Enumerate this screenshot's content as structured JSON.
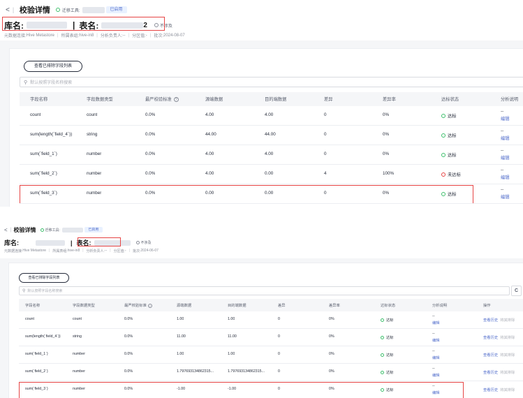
{
  "screenshot1": {
    "header": {
      "back_glyph": "<",
      "page_title": "校验详情",
      "migration_tool_label": "迁移工具:",
      "status_tag": "已启用",
      "db_label": "库名:",
      "table_label": "表名:",
      "table_suffix": "2",
      "partition_status": "不涉及"
    },
    "meta": {
      "metadata_conn_label": "元数据连接: ",
      "metadata_conn_value": "Hive Metastore",
      "table_group_label": "所属表组: ",
      "table_group_value": "hive-in8",
      "owner_label": "分析负责人: ",
      "owner_value": "--",
      "partition_label": "分区值: ",
      "partition_value": "-",
      "batch_label": "批次: ",
      "batch_value": "2024-08-07"
    },
    "view_excluded_button": "查看已排除字段列表",
    "search_placeholder": "默认按照字段名称搜索",
    "columns": [
      "字段名称",
      "字段数据类型",
      "最严校验标准",
      "源端数据",
      "目的端数据",
      "差异",
      "差异率",
      "达标状态",
      "分析说明"
    ],
    "rows": [
      {
        "name": "count",
        "type": "count",
        "standard": "0.0%",
        "src": "4.00",
        "dst": "4.00",
        "diff": "0",
        "rate": "0%",
        "status": "达标",
        "ok": true,
        "note_dash": "--",
        "note_edit": "编辑"
      },
      {
        "name": "sum(length(`field_4`))",
        "type": "string",
        "standard": "0.0%",
        "src": "44.00",
        "dst": "44.00",
        "diff": "0",
        "rate": "0%",
        "status": "达标",
        "ok": true,
        "note_dash": "--",
        "note_edit": "编辑"
      },
      {
        "name": "sum(`field_1`)",
        "type": "number",
        "standard": "0.0%",
        "src": "4.00",
        "dst": "4.00",
        "diff": "0",
        "rate": "0%",
        "status": "达标",
        "ok": true,
        "note_dash": "--",
        "note_edit": "编辑"
      },
      {
        "name": "sum(`field_2`)",
        "type": "number",
        "standard": "0.0%",
        "src": "4.00",
        "dst": "0.00",
        "diff": "4",
        "rate": "100%",
        "status": "未达标",
        "ok": false,
        "note_dash": "--",
        "note_edit": "编辑"
      },
      {
        "name": "sum(`field_3`)",
        "type": "number",
        "standard": "0.0%",
        "src": "0.00",
        "dst": "0.00",
        "diff": "0",
        "rate": "0%",
        "status": "达标",
        "ok": true,
        "note_dash": "--",
        "note_edit": "编辑"
      }
    ]
  },
  "screenshot2": {
    "header": {
      "back_glyph": "<",
      "page_title": "校验详情",
      "migration_tool_label": "迁移工具:",
      "status_tag": "已启用",
      "db_label": "库名:",
      "table_label": "表名:",
      "partition_status": "不涉及"
    },
    "meta": {
      "metadata_conn_label": "元数据连接: ",
      "metadata_conn_value": "Hive Metastore",
      "table_group_label": "所属表组: ",
      "table_group_value": "hive-in8",
      "owner_label": "分析负责人: ",
      "owner_value": "--",
      "partition_label": "分区值: ",
      "partition_value": "-",
      "batch_label": "批次: ",
      "batch_value": "2024-06-07"
    },
    "view_excluded_button": "查看已排除字段列表",
    "search_placeholder": "默认按照字段名称搜索",
    "refresh_glyph": "C",
    "columns": [
      "字段名称",
      "字段数据类型",
      "最严校验标准",
      "源端数据",
      "目的端数据",
      "差异",
      "差异率",
      "达标状态",
      "分析说明",
      "操作"
    ],
    "rows": [
      {
        "name": "count",
        "type": "count",
        "standard": "0.0%",
        "src": "1.00",
        "dst": "1.00",
        "diff": "0",
        "rate": "0%",
        "status": "达标",
        "note_dash": "--",
        "note_edit": "编辑",
        "op_history": "查看历史",
        "op_exclude": "将其排除"
      },
      {
        "name": "sum(length(`field_4`))",
        "type": "string",
        "standard": "0.0%",
        "src": "11.00",
        "dst": "11.00",
        "diff": "0",
        "rate": "0%",
        "status": "达标",
        "note_dash": "--",
        "note_edit": "编辑",
        "op_history": "查看历史",
        "op_exclude": "将其排除"
      },
      {
        "name": "sum(`field_1`)",
        "type": "number",
        "standard": "0.0%",
        "src": "1.00",
        "dst": "1.00",
        "diff": "0",
        "rate": "0%",
        "status": "达标",
        "note_dash": "--",
        "note_edit": "编辑",
        "op_history": "查看历史",
        "op_exclude": "将其排除"
      },
      {
        "name": "sum(`field_2`)",
        "type": "number",
        "standard": "0.0%",
        "src": "1.797693134862315...",
        "dst": "1.797693134862315...",
        "diff": "0",
        "rate": "0%",
        "status": "达标",
        "note_dash": "--",
        "note_edit": "编辑",
        "op_history": "查看历史",
        "op_exclude": "将其排除"
      },
      {
        "name": "sum(`field_3`)",
        "type": "number",
        "standard": "0.0%",
        "src": "-1.00",
        "dst": "-1.00",
        "diff": "0",
        "rate": "0%",
        "status": "达标",
        "note_dash": "--",
        "note_edit": "编辑",
        "op_history": "查看历史",
        "op_exclude": "将其排除"
      }
    ]
  },
  "colors": {
    "ok": "#3fbf6d",
    "bad": "#e64545",
    "link": "#526ecc",
    "highlight_box": "#e64545"
  }
}
